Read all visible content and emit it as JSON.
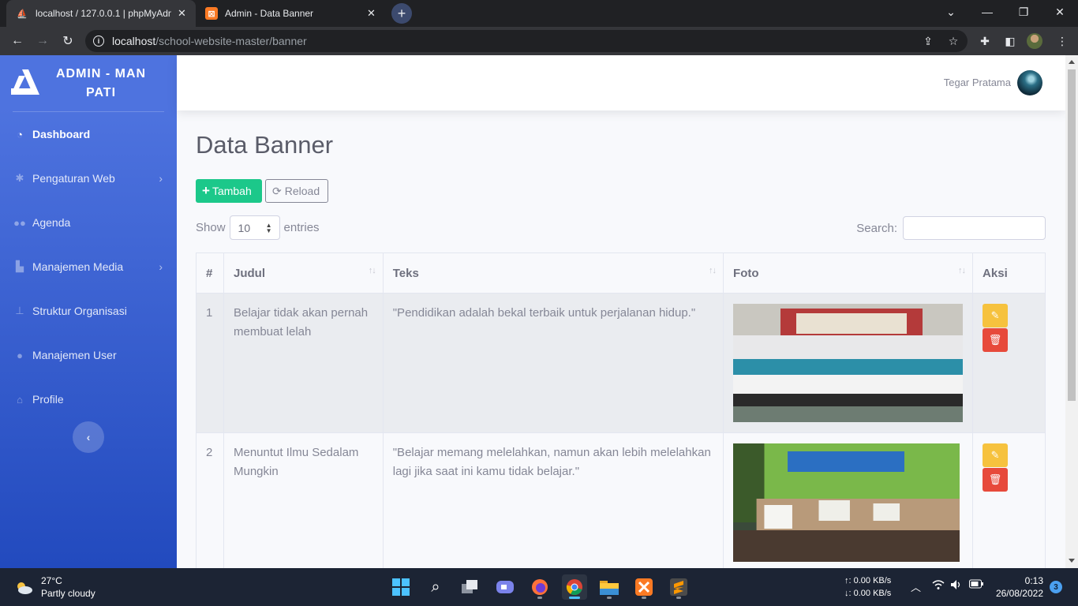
{
  "browser": {
    "tabs": [
      {
        "title": "localhost / 127.0.0.1 | phpMyAdm",
        "icon": "phpmyadmin-icon"
      },
      {
        "title": "Admin - Data Banner",
        "icon": "xampp-icon"
      }
    ],
    "address": {
      "host": "localhost",
      "path": "/school-website-master/banner"
    }
  },
  "sidebar": {
    "brand": "ADMIN - MAN PATI",
    "items": [
      {
        "label": "Dashboard",
        "icon": "tachometer-icon",
        "active": true
      },
      {
        "label": "Pengaturan Web",
        "icon": "cog-icon",
        "has_submenu": true
      },
      {
        "label": "Agenda",
        "icon": "users-icon"
      },
      {
        "label": "Manajemen Media",
        "icon": "industry-icon",
        "has_submenu": true
      },
      {
        "label": "Struktur Organisasi",
        "icon": "sitemap-icon"
      },
      {
        "label": "Manajemen User",
        "icon": "user-icon"
      },
      {
        "label": "Profile",
        "icon": "home-icon"
      }
    ]
  },
  "topbar": {
    "username": "Tegar Pratama"
  },
  "page": {
    "title": "Data Banner",
    "add_label": "Tambah",
    "reload_label": "Reload",
    "show_label": "Show",
    "entries_value": "10",
    "entries_label": "entries",
    "search_label": "Search:"
  },
  "table": {
    "headers": [
      "#",
      "Judul",
      "Teks",
      "Foto",
      "Aksi"
    ],
    "rows": [
      {
        "no": "1",
        "judul": "Belajar tidak akan pernah membuat lelah",
        "teks": "\"Pendidikan adalah bekal terbaik untuk perjalanan hidup.\""
      },
      {
        "no": "2",
        "judul": "Menuntut Ilmu Sedalam Mungkin",
        "teks": "\"Belajar memang melelahkan, namun akan lebih melelahkan lagi jika saat ini kamu tidak belajar.\""
      }
    ]
  },
  "taskbar": {
    "weather_temp": "27°C",
    "weather_desc": "Partly cloudy",
    "net_up": "↑: 0.00 KB/s",
    "net_down": "↓: 0.00 KB/s",
    "time": "0:13",
    "date": "26/08/2022",
    "notifications": "3"
  },
  "colors": {
    "primary": "#4e73df",
    "success": "#1cc88a",
    "warning": "#f6c23e",
    "danger": "#e74a3b"
  }
}
